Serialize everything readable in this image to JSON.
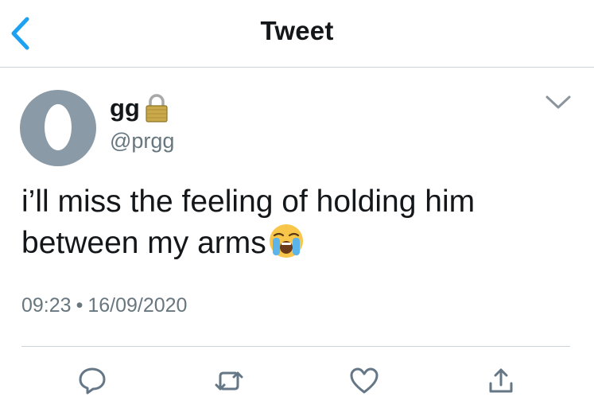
{
  "header": {
    "title": "Tweet",
    "back_icon": "chevron-left-icon",
    "accent_color": "#1da1f2"
  },
  "tweet": {
    "author": {
      "display_name": "gg",
      "handle": "@prgg",
      "protected_icon": "lock-icon"
    },
    "text_line1": "i’ll miss the feeling of holding him",
    "text_line2": "between my arms",
    "emoji": "loudly-crying-face-emoji",
    "time": "09:23",
    "date": "16/09/2020",
    "separator": "•"
  },
  "actions": [
    {
      "icon": "reply-icon"
    },
    {
      "icon": "retweet-icon"
    },
    {
      "icon": "like-heart-icon"
    },
    {
      "icon": "share-icon"
    }
  ],
  "colors": {
    "text": "#14171a",
    "secondary": "#68777f",
    "divider": "#cfd4d8",
    "avatar": "#8a9aa7"
  }
}
